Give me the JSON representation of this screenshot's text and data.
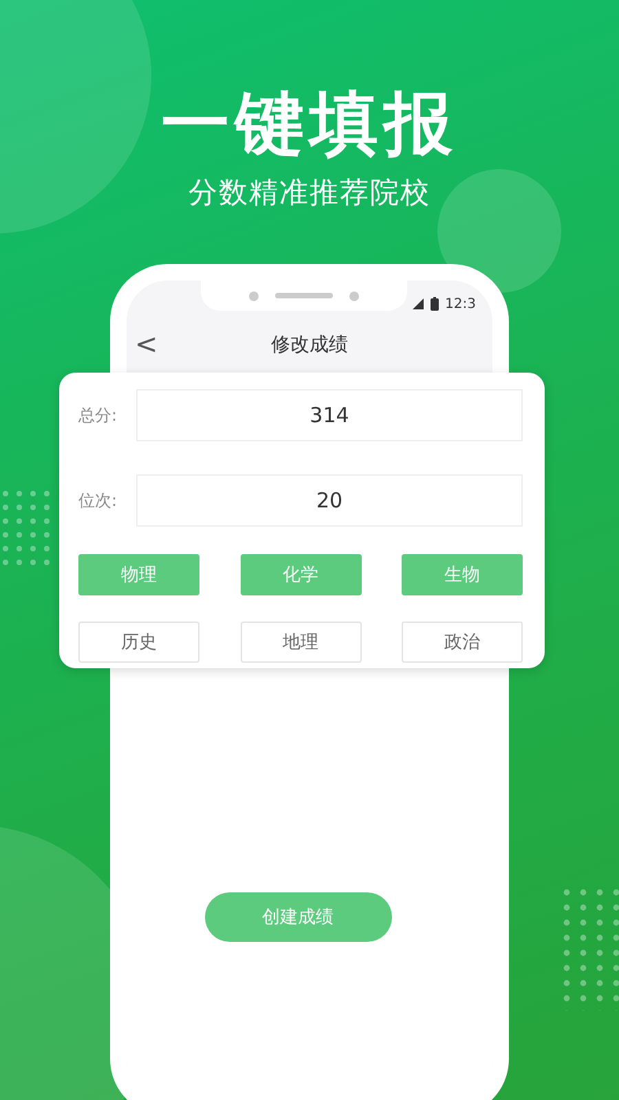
{
  "headline": "一键填报",
  "subtitle": "分数精准推荐院校",
  "status_bar": {
    "time": "12:3"
  },
  "nav": {
    "back": "<",
    "title": "修改成绩"
  },
  "fields": [
    {
      "label": "总分:",
      "value": "314"
    },
    {
      "label": "位次:",
      "value": "20"
    }
  ],
  "subjects": [
    {
      "label": "物理",
      "selected": true
    },
    {
      "label": "化学",
      "selected": true
    },
    {
      "label": "生物",
      "selected": true
    },
    {
      "label": "历史",
      "selected": false
    },
    {
      "label": "地理",
      "selected": false
    },
    {
      "label": "政治",
      "selected": false
    }
  ],
  "create_button": "创建成绩"
}
